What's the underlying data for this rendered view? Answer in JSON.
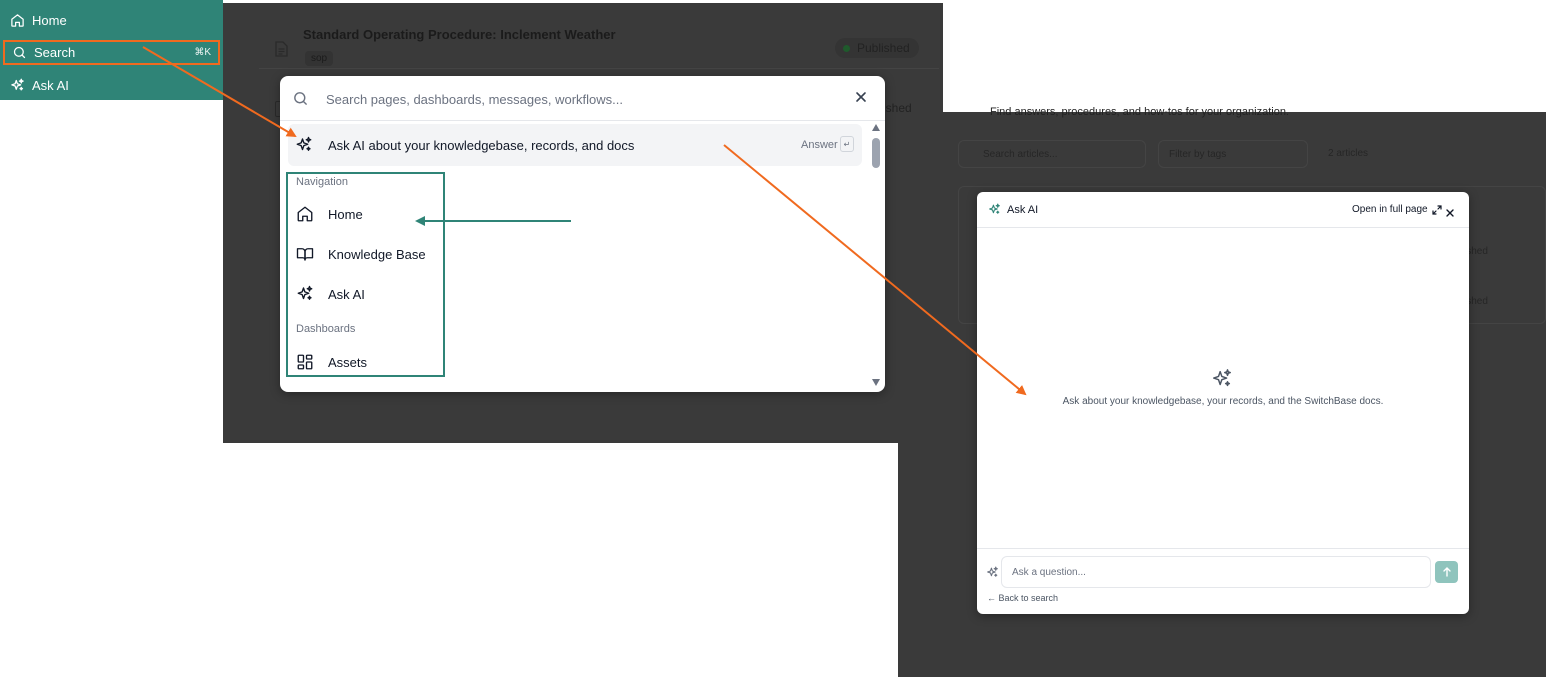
{
  "sidebar": {
    "items": [
      {
        "label": "Home",
        "icon": "home-icon"
      },
      {
        "label": "Search",
        "icon": "search-icon",
        "shortcut": "⌘K"
      },
      {
        "label": "Ask AI",
        "icon": "sparkles-icon"
      }
    ],
    "background": "#2f8477"
  },
  "background_page": {
    "article_title": "Standard Operating Procedure: Inclement Weather",
    "article_tag": "sop",
    "article_status": "Published",
    "second_status": "ished"
  },
  "palette": {
    "search_placeholder": "Search pages, dashboards, messages, workflows...",
    "ask_ai_label": "Ask AI about your knowledgebase, records, and docs",
    "ask_ai_hint": "Answer",
    "enter_key": "↵",
    "groups": [
      {
        "label": "Navigation",
        "items": [
          {
            "label": "Home",
            "icon": "home-icon"
          },
          {
            "label": "Knowledge Base",
            "icon": "book-open-icon"
          },
          {
            "label": "Ask AI",
            "icon": "sparkles-icon"
          }
        ]
      },
      {
        "label": "Dashboards",
        "items": [
          {
            "label": "Assets",
            "icon": "layout-dashboard-icon"
          }
        ]
      }
    ]
  },
  "right_background": {
    "subtitle": "Find answers, procedures, and how-tos for your organization.",
    "search_placeholder": "Search articles...",
    "filter_label": "Filter by tags",
    "count": "2 articles",
    "status_1": "ished",
    "status_2": "ished"
  },
  "ask_ai_dialog": {
    "title": "Ask AI",
    "open_full_page": "Open in full page",
    "empty_message": "Ask about your knowledgebase, your records, and the SwitchBase docs.",
    "input_placeholder": "Ask a question...",
    "back_link": "← Back to search"
  },
  "colors": {
    "accent": "#2f8477",
    "annotation_orange": "#f06a1f",
    "annotation_teal": "#2f8477",
    "send_button": "#8fc4bd"
  }
}
